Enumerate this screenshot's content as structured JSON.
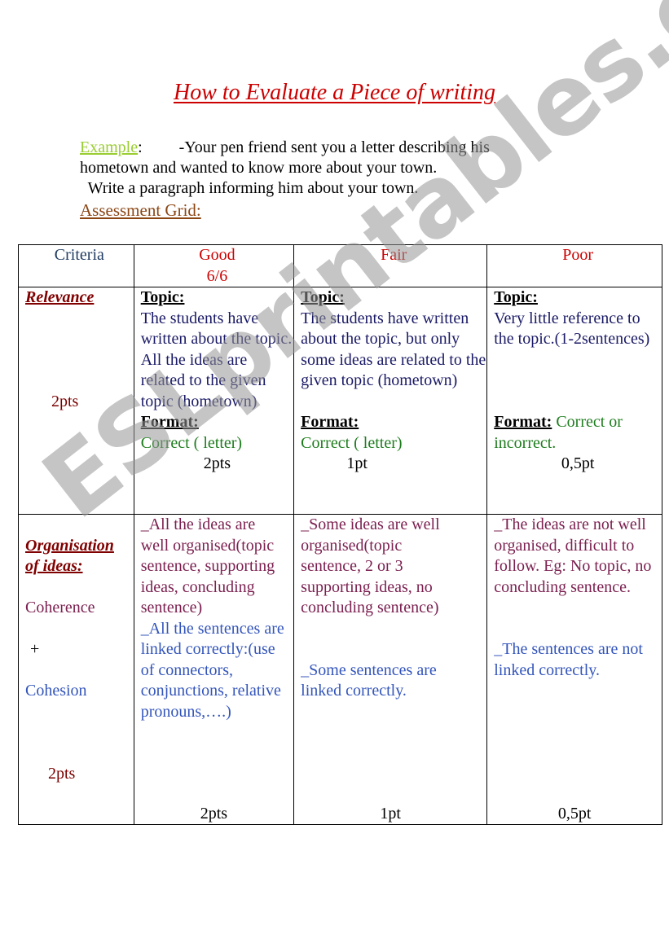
{
  "title": "How to Evaluate a Piece of writing",
  "intro": {
    "example_label": "Example",
    "example_colon": ":",
    "line1": "         -Your pen friend sent you a letter describing his",
    "line2": "hometown and wanted to know more about your town.",
    "line3": "  Write a paragraph informing him about your town."
  },
  "assessment_label": "Assessment Grid:",
  "watermark": "ESLprintables.com",
  "table": {
    "headers": {
      "criteria": "Criteria",
      "good": "Good",
      "good_score": "6/6",
      "fair": "Fair",
      "poor": "Poor"
    },
    "relevance": {
      "criterion": "Relevance",
      "points": "2pts",
      "good": {
        "topic_label": "Topic:",
        "topic_text": "The students have written about the topic. All the ideas are related to the given topic (hometown)",
        "format_label": "Format:",
        "format_text": "Correct ( letter)",
        "score": "2pts"
      },
      "fair": {
        "topic_label": "Topic:",
        "topic_text": "The students have written about the topic, but only some ideas are related to the given topic (hometown)",
        "format_label": "Format:",
        "format_text": "Correct ( letter)",
        "score": "1pt"
      },
      "poor": {
        "topic_label": "Topic:",
        "topic_text": "Very little reference to the topic.(1-2sentences)",
        "format_label": "Format:",
        "format_text": "Correct or incorrect.",
        "score": "0,5pt"
      }
    },
    "organisation": {
      "criterion_line1": "Organisation",
      "criterion_line2": "of ideas:",
      "coherence": "Coherence",
      "plus": "+",
      "cohesion": "Cohesion",
      "points": "2pts",
      "good": {
        "coherence_text": "_All the ideas are well organised(topic sentence, supporting ideas, concluding sentence)",
        "cohesion_text": "_All the sentences are linked correctly:(use of connectors, conjunctions, relative pronouns,….)",
        "score": "2pts"
      },
      "fair": {
        "coherence_text": "_Some ideas are well organised(topic sentence, 2 or 3 supporting ideas,  no concluding sentence)",
        "cohesion_text": "_Some sentences are linked correctly.",
        "score": "1pt"
      },
      "poor": {
        "coherence_text": "_The ideas are not well organised, difficult to follow. Eg: No topic, no concluding sentence.",
        "cohesion_text": "_The sentences are not linked correctly.",
        "score": "0,5pt"
      }
    }
  }
}
